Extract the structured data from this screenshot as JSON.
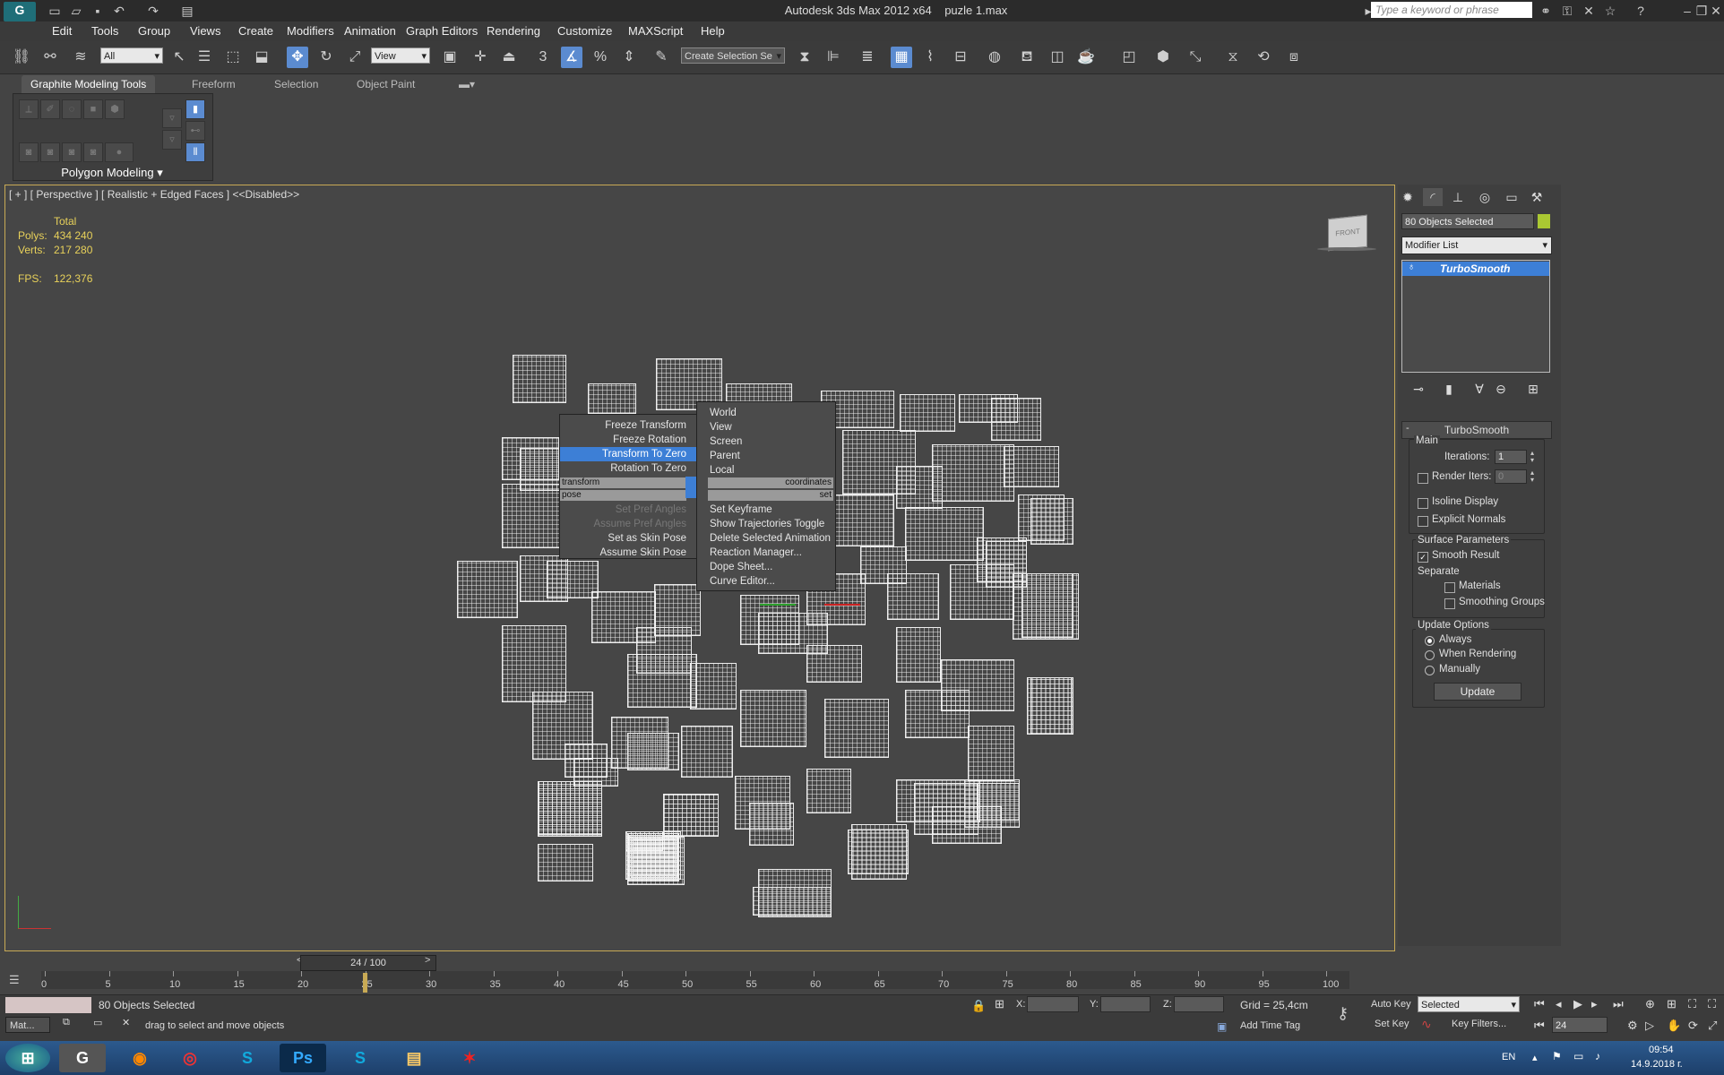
{
  "titlebar": {
    "app_title": "Autodesk 3ds Max  2012 x64",
    "file": "puzle 1.max",
    "search_placeholder": "Type a keyword or phrase"
  },
  "menu": [
    "Edit",
    "Tools",
    "Group",
    "Views",
    "Create",
    "Modifiers",
    "Animation",
    "Graph Editors",
    "Rendering",
    "Customize",
    "MAXScript",
    "Help"
  ],
  "toolbar": {
    "filter": "All",
    "ref_coord": "View",
    "selection_set": "Create Selection Se",
    "snap_3": "3",
    "percent": "%"
  },
  "ribbon": {
    "tabs": [
      "Graphite Modeling Tools",
      "Freeform",
      "Selection",
      "Object Paint"
    ],
    "panel_label": "Polygon Modeling"
  },
  "viewport": {
    "label": "[ + ] [ Perspective ] [ Realistic + Edged Faces ] <<Disabled>>",
    "stats": {
      "total": "Total",
      "polys_label": "Polys:",
      "polys": "434 240",
      "verts_label": "Verts:",
      "verts": "217 280",
      "fps_label": "FPS:",
      "fps": "122,376"
    },
    "viewcube": "FRONT"
  },
  "quadmenu": {
    "left_top": [
      "Freeze Transform",
      "Freeze Rotation",
      "Transform To Zero",
      "Rotation To Zero"
    ],
    "left_hdr1": "transform",
    "left_hdr2": "pose",
    "right_hdr1": "coordinates",
    "right_hdr2": "set",
    "left_bottom": [
      "Set Pref Angles",
      "Assume Pref Angles",
      "Set as Skin Pose",
      "Assume Skin Pose"
    ],
    "right_top": [
      "World",
      "View",
      "Screen",
      "Parent",
      "Local"
    ],
    "right_bottom": [
      "Set Keyframe",
      "Show Trajectories Toggle",
      "Delete Selected Animation",
      "Reaction Manager...",
      "Dope Sheet...",
      "Curve Editor..."
    ]
  },
  "cmdpanel": {
    "selection": "80 Objects Selected",
    "modifier_list": "Modifier List",
    "stack_item": "TurboSmooth",
    "rollout_title": "TurboSmooth",
    "main": "Main",
    "iterations_label": "Iterations:",
    "iterations": "1",
    "render_iters_label": "Render Iters:",
    "render_iters": "0",
    "isoline": "Isoline Display",
    "explicit_normals": "Explicit Normals",
    "surface_params": "Surface Parameters",
    "smooth_result": "Smooth Result",
    "separate": "Separate",
    "materials": "Materials",
    "smoothing_groups": "Smoothing Groups",
    "update_options": "Update Options",
    "always": "Always",
    "when_rendering": "When Rendering",
    "manually": "Manually",
    "update": "Update"
  },
  "timeline": {
    "frame": "24 / 100",
    "ticks": [
      "0",
      "5",
      "10",
      "15",
      "20",
      "25",
      "30",
      "35",
      "40",
      "45",
      "50",
      "55",
      "60",
      "65",
      "70",
      "75",
      "80",
      "85",
      "90",
      "95",
      "100"
    ]
  },
  "status": {
    "selected": "80 Objects Selected",
    "prompt": "drag to select and move objects",
    "mini_listener": "Mat...",
    "x": "X:",
    "y": "Y:",
    "z": "Z:",
    "grid": "Grid = 25,4cm",
    "add_time_tag": "Add Time Tag",
    "auto_key": "Auto Key",
    "set_key": "Set Key",
    "key_mode": "Selected",
    "key_filters": "Key Filters...",
    "current_frame": "24"
  },
  "taskbar": {
    "lang": "EN",
    "time": "09:54",
    "date": "14.9.2018 г."
  }
}
